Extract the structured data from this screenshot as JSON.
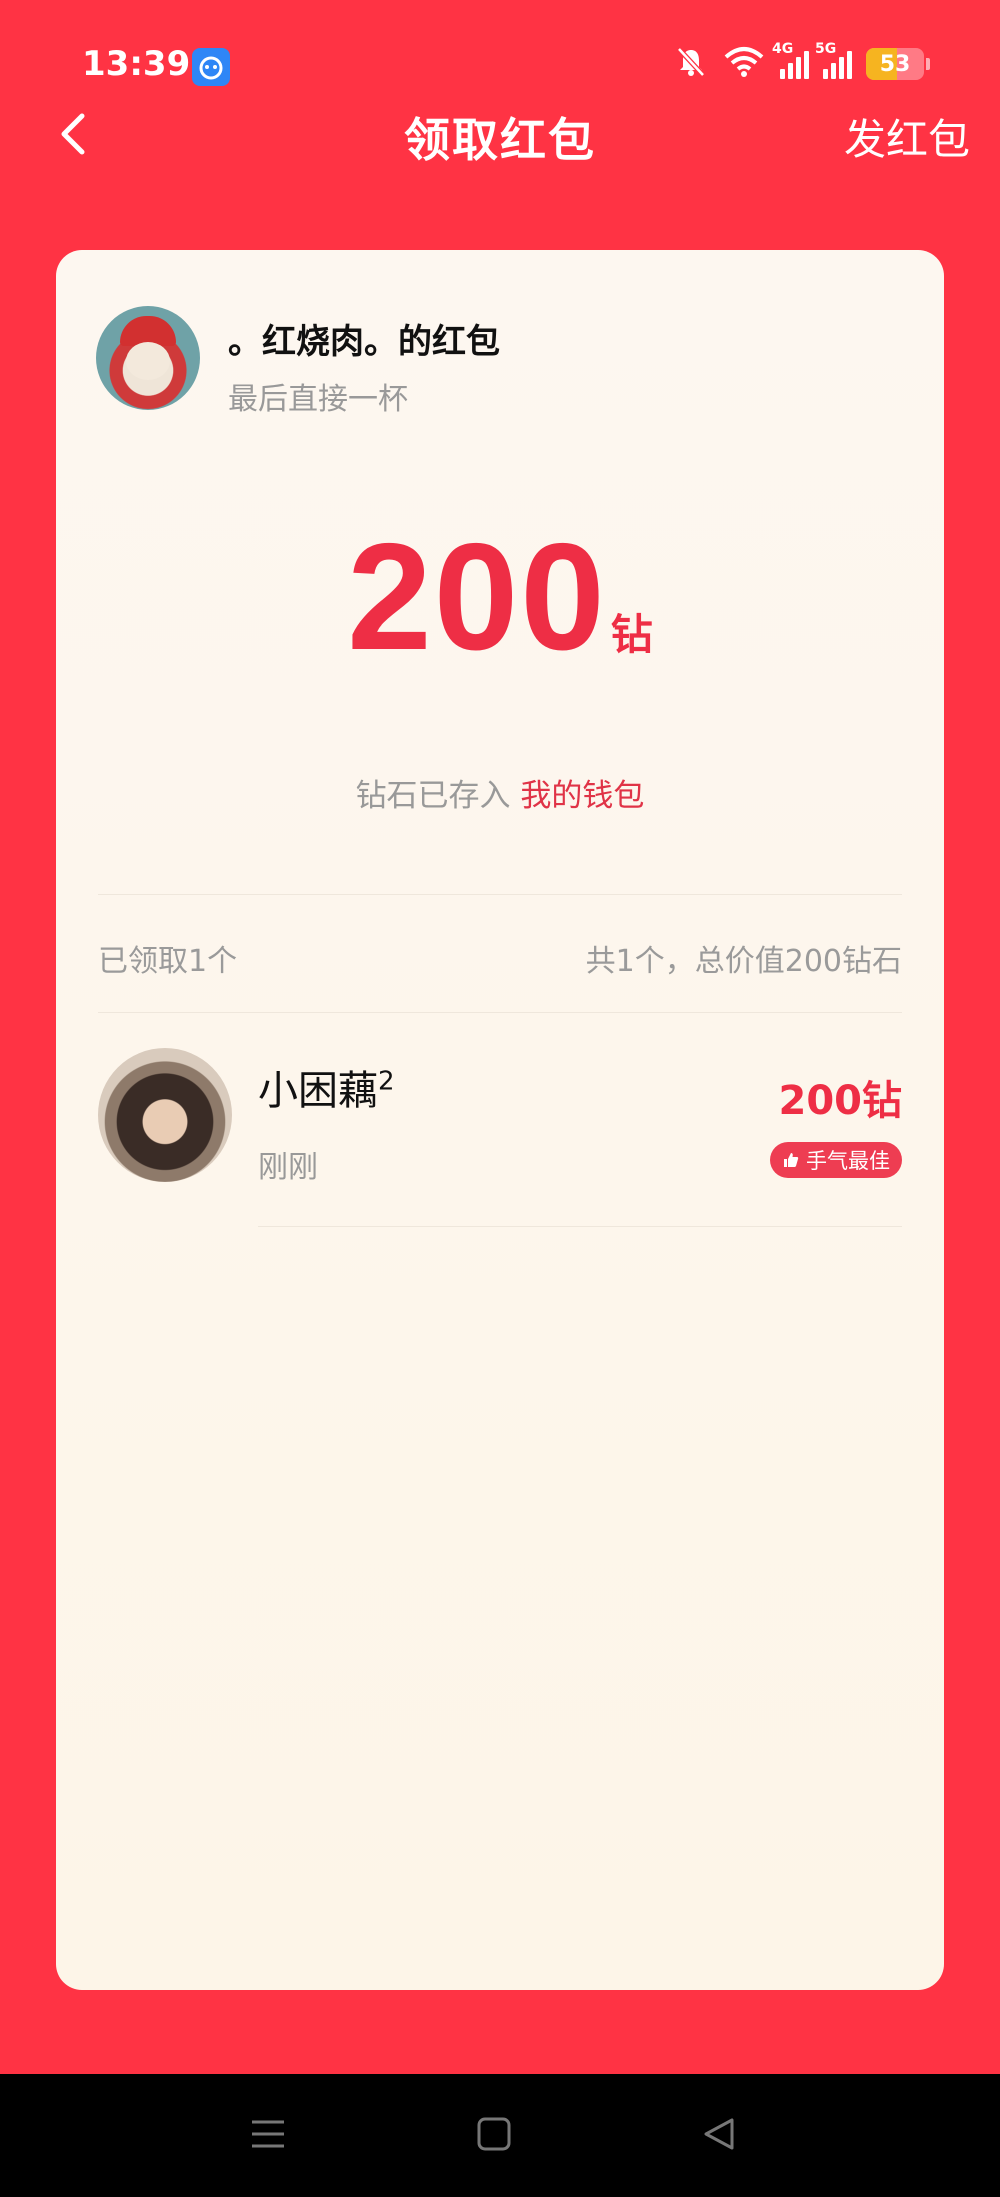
{
  "status_bar": {
    "time": "13:39",
    "network_4g_label": "4G",
    "network_5g_label": "5G",
    "battery_level": "53",
    "battery_color": "#f6b420"
  },
  "nav": {
    "title": "领取红包",
    "send_label": "发红包",
    "back_icon": "chevron-left-icon"
  },
  "packet": {
    "sender_name": "。红烧肉。的红包",
    "greeting": "最后直接一杯",
    "amount": "200",
    "unit": "钻",
    "deposit_prefix": "钻石已存入",
    "wallet_link": "我的钱包"
  },
  "summary": {
    "claimed": "已领取1个",
    "total": "共1个，总价值200钻石"
  },
  "recipients": [
    {
      "name": "小困藕",
      "name_superscript": "2",
      "time": "刚刚",
      "amount": "200钻",
      "badge": "手气最佳"
    }
  ],
  "colors": {
    "background": "#ff3344",
    "accent": "#ee2e45",
    "card": "#fdf7f0"
  }
}
